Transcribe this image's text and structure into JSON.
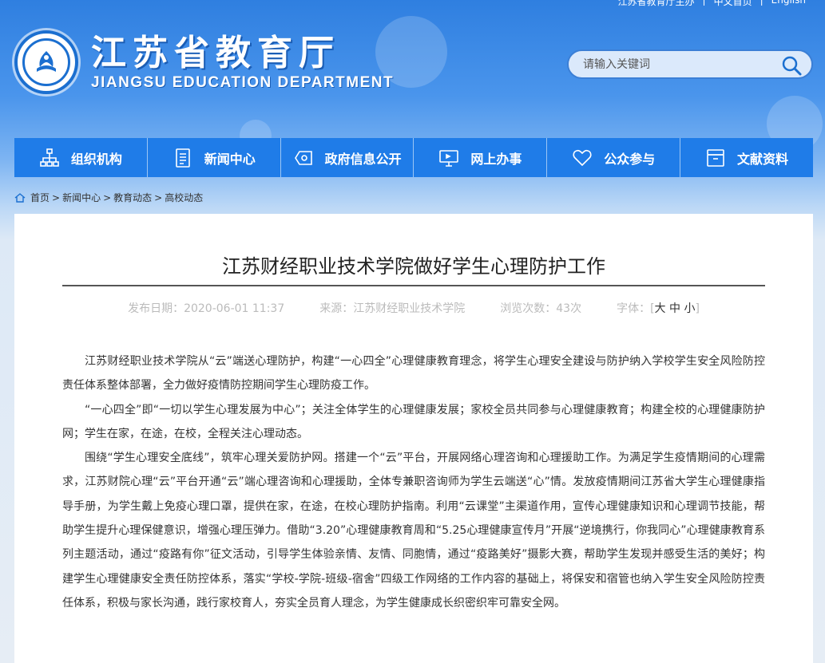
{
  "header": {
    "top_links": [
      "江苏省教育厅主办",
      "中文首页",
      "English"
    ],
    "logo_cn": "江苏省教育厅",
    "logo_en": "JIANGSU EDUCATION DEPARTMENT",
    "search_placeholder": "请输入关键词"
  },
  "nav": {
    "items": [
      {
        "label": "组织机构",
        "icon": "org-chart-icon"
      },
      {
        "label": "新闻中心",
        "icon": "document-icon"
      },
      {
        "label": "政府信息公开",
        "icon": "info-disclosure-icon"
      },
      {
        "label": "网上办事",
        "icon": "monitor-icon"
      },
      {
        "label": "公众参与",
        "icon": "heart-icon"
      },
      {
        "label": "文献资料",
        "icon": "archive-icon"
      }
    ]
  },
  "breadcrumb": {
    "items": [
      "首页",
      "新闻中心",
      "教育动态",
      "高校动态"
    ],
    "separator": ">"
  },
  "article": {
    "title": "江苏财经职业技术学院做好学生心理防护工作",
    "publish_date": "发布日期：2020-06-01 11:37",
    "source": "来源：江苏财经职业技术学院",
    "views": "浏览次数：43次",
    "font_size_label": "字体：",
    "font_size_open": "[",
    "font_large": "大",
    "font_medium": "中",
    "font_small": "小",
    "font_size_close": "]",
    "paragraphs": [
      "江苏财经职业技术学院从“云”端送心理防护，构建“一心四全”心理健康教育理念，将学生心理安全建设与防护纳入学校学生安全风险防控责任体系整体部署，全力做好疫情防控期间学生心理防疫工作。",
      "“一心四全”即“一切以学生心理发展为中心”；关注全体学生的心理健康发展；家校全员共同参与心理健康教育；构建全校的心理健康防护网；学生在家，在途，在校，全程关注心理动态。",
      "围绕“学生心理安全底线”，筑牢心理关爱防护网。搭建一个“云”平台，开展网络心理咨询和心理援助工作。为满足学生疫情期间的心理需求，江苏财院心理“云”平台开通“云”端心理咨询和心理援助，全体专兼职咨询师为学生云端送“心”情。发放疫情期间江苏省大学生心理健康指导手册，为学生戴上免疫心理口罩，提供在家，在途，在校心理防护指南。利用“云课堂”主渠道作用，宣传心理健康知识和心理调节技能，帮助学生提升心理保健意识，增强心理压弹力。借助“3.20”心理健康教育周和“5.25心理健康宣传月”开展“逆境携行，你我同心”心理健康教育系列主题活动，通过“疫路有你”征文活动，引导学生体验亲情、友情、同胞情，通过“疫路美好”摄影大赛，帮助学生发现并感受生活的美好；构建学生心理健康安全责任防控体系，落实“学校-学院-班级-宿舍”四级工作网络的工作内容的基础上，将保安和宿管也纳入学生安全风险防控责任体系，积极与家长沟通，践行家校育人，夯实全员育人理念，为学生健康成长织密织牢可靠安全网。"
    ]
  },
  "colors": {
    "nav_bg": "#1f7ce8",
    "header_bg": "#2f7fe0",
    "panel_bg": "#ffffff"
  }
}
